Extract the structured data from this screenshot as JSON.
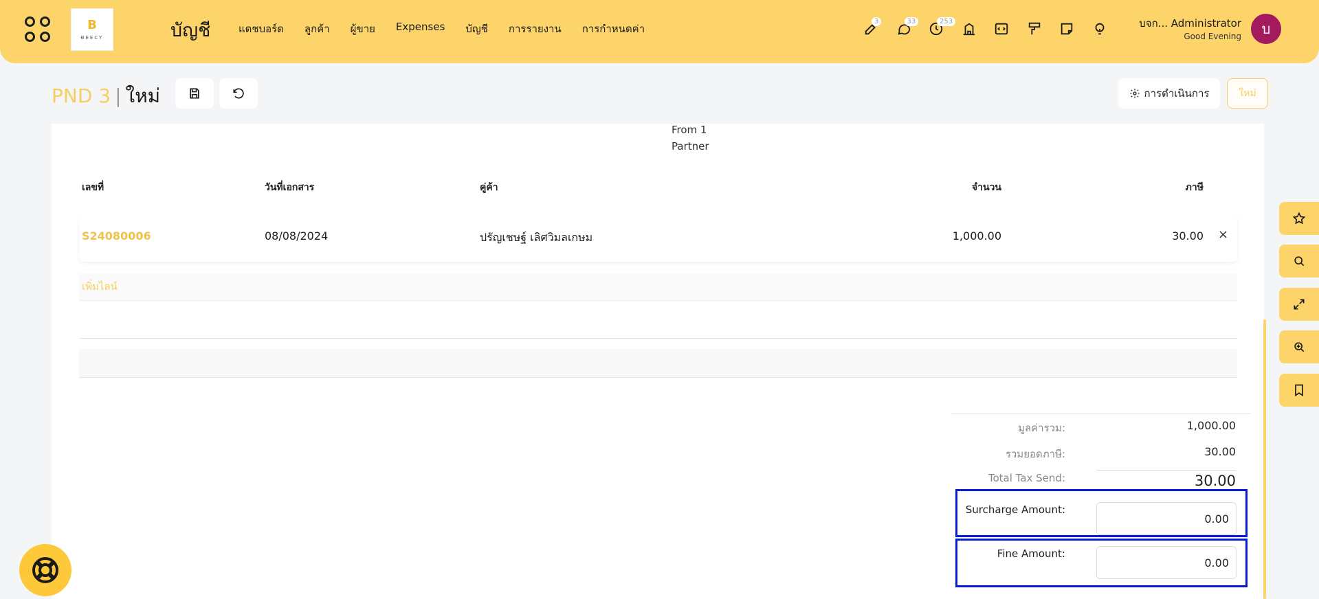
{
  "header": {
    "logo_text": "BEECY",
    "app_title": "บัญชี",
    "nav": [
      "แดชบอร์ด",
      "ลูกค้า",
      "ผู้ขาย",
      "Expenses",
      "บัญชี",
      "การรายงาน",
      "การกำหนดค่า"
    ],
    "badges": {
      "activities": "3",
      "messages": "33",
      "clock": "253"
    },
    "user_name": "บจก... Administrator",
    "greeting": "Good Evening",
    "avatar_letter": "บ"
  },
  "breadcrumb": {
    "parent": "PND 3",
    "separator": "|",
    "current": "ใหม่"
  },
  "actions": {
    "action_label": "การดำเนินการ",
    "new_label": "ใหม่"
  },
  "form": {
    "from_line1": "From 1",
    "from_line2": "Partner",
    "columns": {
      "number": "เลขที่",
      "date": "วันที่เอกสาร",
      "partner": "คู่ค้า",
      "amount": "จำนวน",
      "tax": "ภาษี"
    },
    "rows": [
      {
        "number": "S24080006",
        "date": "08/08/2024",
        "partner": "ปรัญเชษฐ์ เลิศวิมลเกษม",
        "amount": "1,000.00",
        "tax": "30.00",
        "remove": "×"
      }
    ],
    "add_line": "เพิ่มไลน์"
  },
  "totals": {
    "subtotal_label": "มูลค่ารวม:",
    "subtotal_value": "1,000.00",
    "tax_total_label": "รวมยอดภาษี:",
    "tax_total_value": "30.00",
    "tax_send_label": "Total Tax Send:",
    "tax_send_value": "30.00",
    "surcharge_label": "Surcharge Amount:",
    "surcharge_value": "0.00",
    "fine_label": "Fine Amount:",
    "fine_value": "0.00"
  },
  "colors": {
    "accent": "#fdd46a",
    "highlight": "#0a1bd6",
    "avatar": "#a31a5e"
  }
}
